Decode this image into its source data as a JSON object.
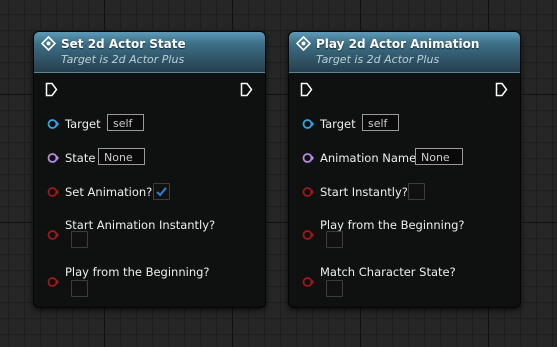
{
  "colors": {
    "object_pin": "#2fa5e6",
    "enum_pin": "#b98be3",
    "bool_pin": "#a11818",
    "check": "#2f7fd4"
  },
  "nodes": [
    {
      "title": "Set 2d Actor State",
      "subtitle": "Target is 2d Actor Plus",
      "icon": "function-icon",
      "inputs": {
        "target_label": "Target",
        "target_value": "self",
        "state_label": "State",
        "state_value": "None",
        "set_animation_label": "Set Animation?",
        "set_animation_checked": true,
        "start_instantly_label": "Start Animation Instantly?",
        "start_instantly_checked": false,
        "play_beginning_label": "Play from the Beginning?",
        "play_beginning_checked": false
      }
    },
    {
      "title": "Play 2d Actor Animation",
      "subtitle": "Target is 2d Actor Plus",
      "icon": "function-icon",
      "inputs": {
        "target_label": "Target",
        "target_value": "self",
        "anim_name_label": "Animation Name",
        "anim_name_value": "None",
        "start_instantly_label": "Start Instantly?",
        "start_instantly_checked": false,
        "play_beginning_label": "Play from the Beginning?",
        "play_beginning_checked": false,
        "match_state_label": "Match Character State?",
        "match_state_checked": false
      }
    }
  ]
}
